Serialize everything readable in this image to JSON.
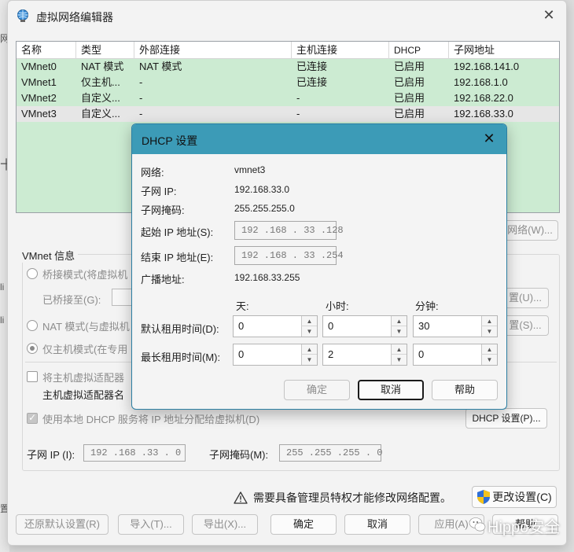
{
  "window": {
    "title": "虚拟网络编辑器"
  },
  "table": {
    "headers": [
      "名称",
      "类型",
      "外部连接",
      "主机连接",
      "DHCP",
      "子网地址"
    ],
    "rows": [
      [
        "VMnet0",
        "NAT 模式",
        "NAT 模式",
        "已连接",
        "已启用",
        "192.168.141.0"
      ],
      [
        "VMnet1",
        "仅主机...",
        "-",
        "已连接",
        "已启用",
        "192.168.1.0"
      ],
      [
        "VMnet2",
        "自定义...",
        "-",
        "-",
        "已启用",
        "192.168.22.0"
      ],
      [
        "VMnet3",
        "自定义...",
        "-",
        "-",
        "已启用",
        "192.168.33.0"
      ]
    ]
  },
  "vmnet_info": {
    "title": "VMnet 信息",
    "bridge_label": "桥接模式(将虚拟机",
    "bridged_to_label": "已桥接至(G):",
    "nat_label": "NAT 模式(与虚拟机",
    "hostonly_label": "仅主机模式(在专用",
    "connect_adapter_label": "将主机虚拟适配器",
    "adapter_name_label": "主机虚拟适配器名",
    "use_dhcp_label": "使用本地 DHCP 服务将 IP 地址分配给虚拟机(D)",
    "dhcp_settings_button": "DHCP 设置(P)...",
    "subnet_ip_label": "子网 IP (I):",
    "subnet_ip_value": "192 .168 .33 . 0",
    "subnet_mask_label": "子网掩码(M):",
    "subnet_mask_value": "255 .255 .255 . 0",
    "right_btn_network": "网络(W)...",
    "right_btn_settings_u": "置(U)...",
    "right_btn_settings_s": "置(S)..."
  },
  "warning_text": "需要具备管理员特权才能修改网络配置。",
  "change_settings_button": "更改设置(C)",
  "bottom_buttons": {
    "restore": "还原默认设置(R)",
    "import": "导入(T)...",
    "export": "导出(X)...",
    "ok": "确定",
    "cancel": "取消",
    "apply": "应用(A)",
    "help": "帮助"
  },
  "dhcp_dialog": {
    "title": "DHCP 设置",
    "network_label": "网络:",
    "network_value": "vmnet3",
    "subnet_ip_label": "子网 IP:",
    "subnet_ip_value": "192.168.33.0",
    "subnet_mask_label": "子网掩码:",
    "subnet_mask_value": "255.255.255.0",
    "start_ip_label": "起始 IP 地址(S):",
    "start_ip_value": "192 .168 . 33 .128",
    "end_ip_label": "结束 IP 地址(E):",
    "end_ip_value": "192 .168 . 33 .254",
    "broadcast_label": "广播地址:",
    "broadcast_value": "192.168.33.255",
    "col_days": "天:",
    "col_hours": "小时:",
    "col_minutes": "分钟:",
    "default_lease_label": "默认租用时间(D):",
    "default_lease": {
      "days": "0",
      "hours": "0",
      "minutes": "30"
    },
    "max_lease_label": "最长租用时间(M):",
    "max_lease": {
      "days": "0",
      "hours": "2",
      "minutes": "0"
    },
    "ok_button": "确定",
    "cancel_button": "取消",
    "help_button": "帮助"
  },
  "watermark": "Hippo安全",
  "left_edge_glyphs": [
    "网",
    "十",
    "li",
    "li",
    "置"
  ]
}
